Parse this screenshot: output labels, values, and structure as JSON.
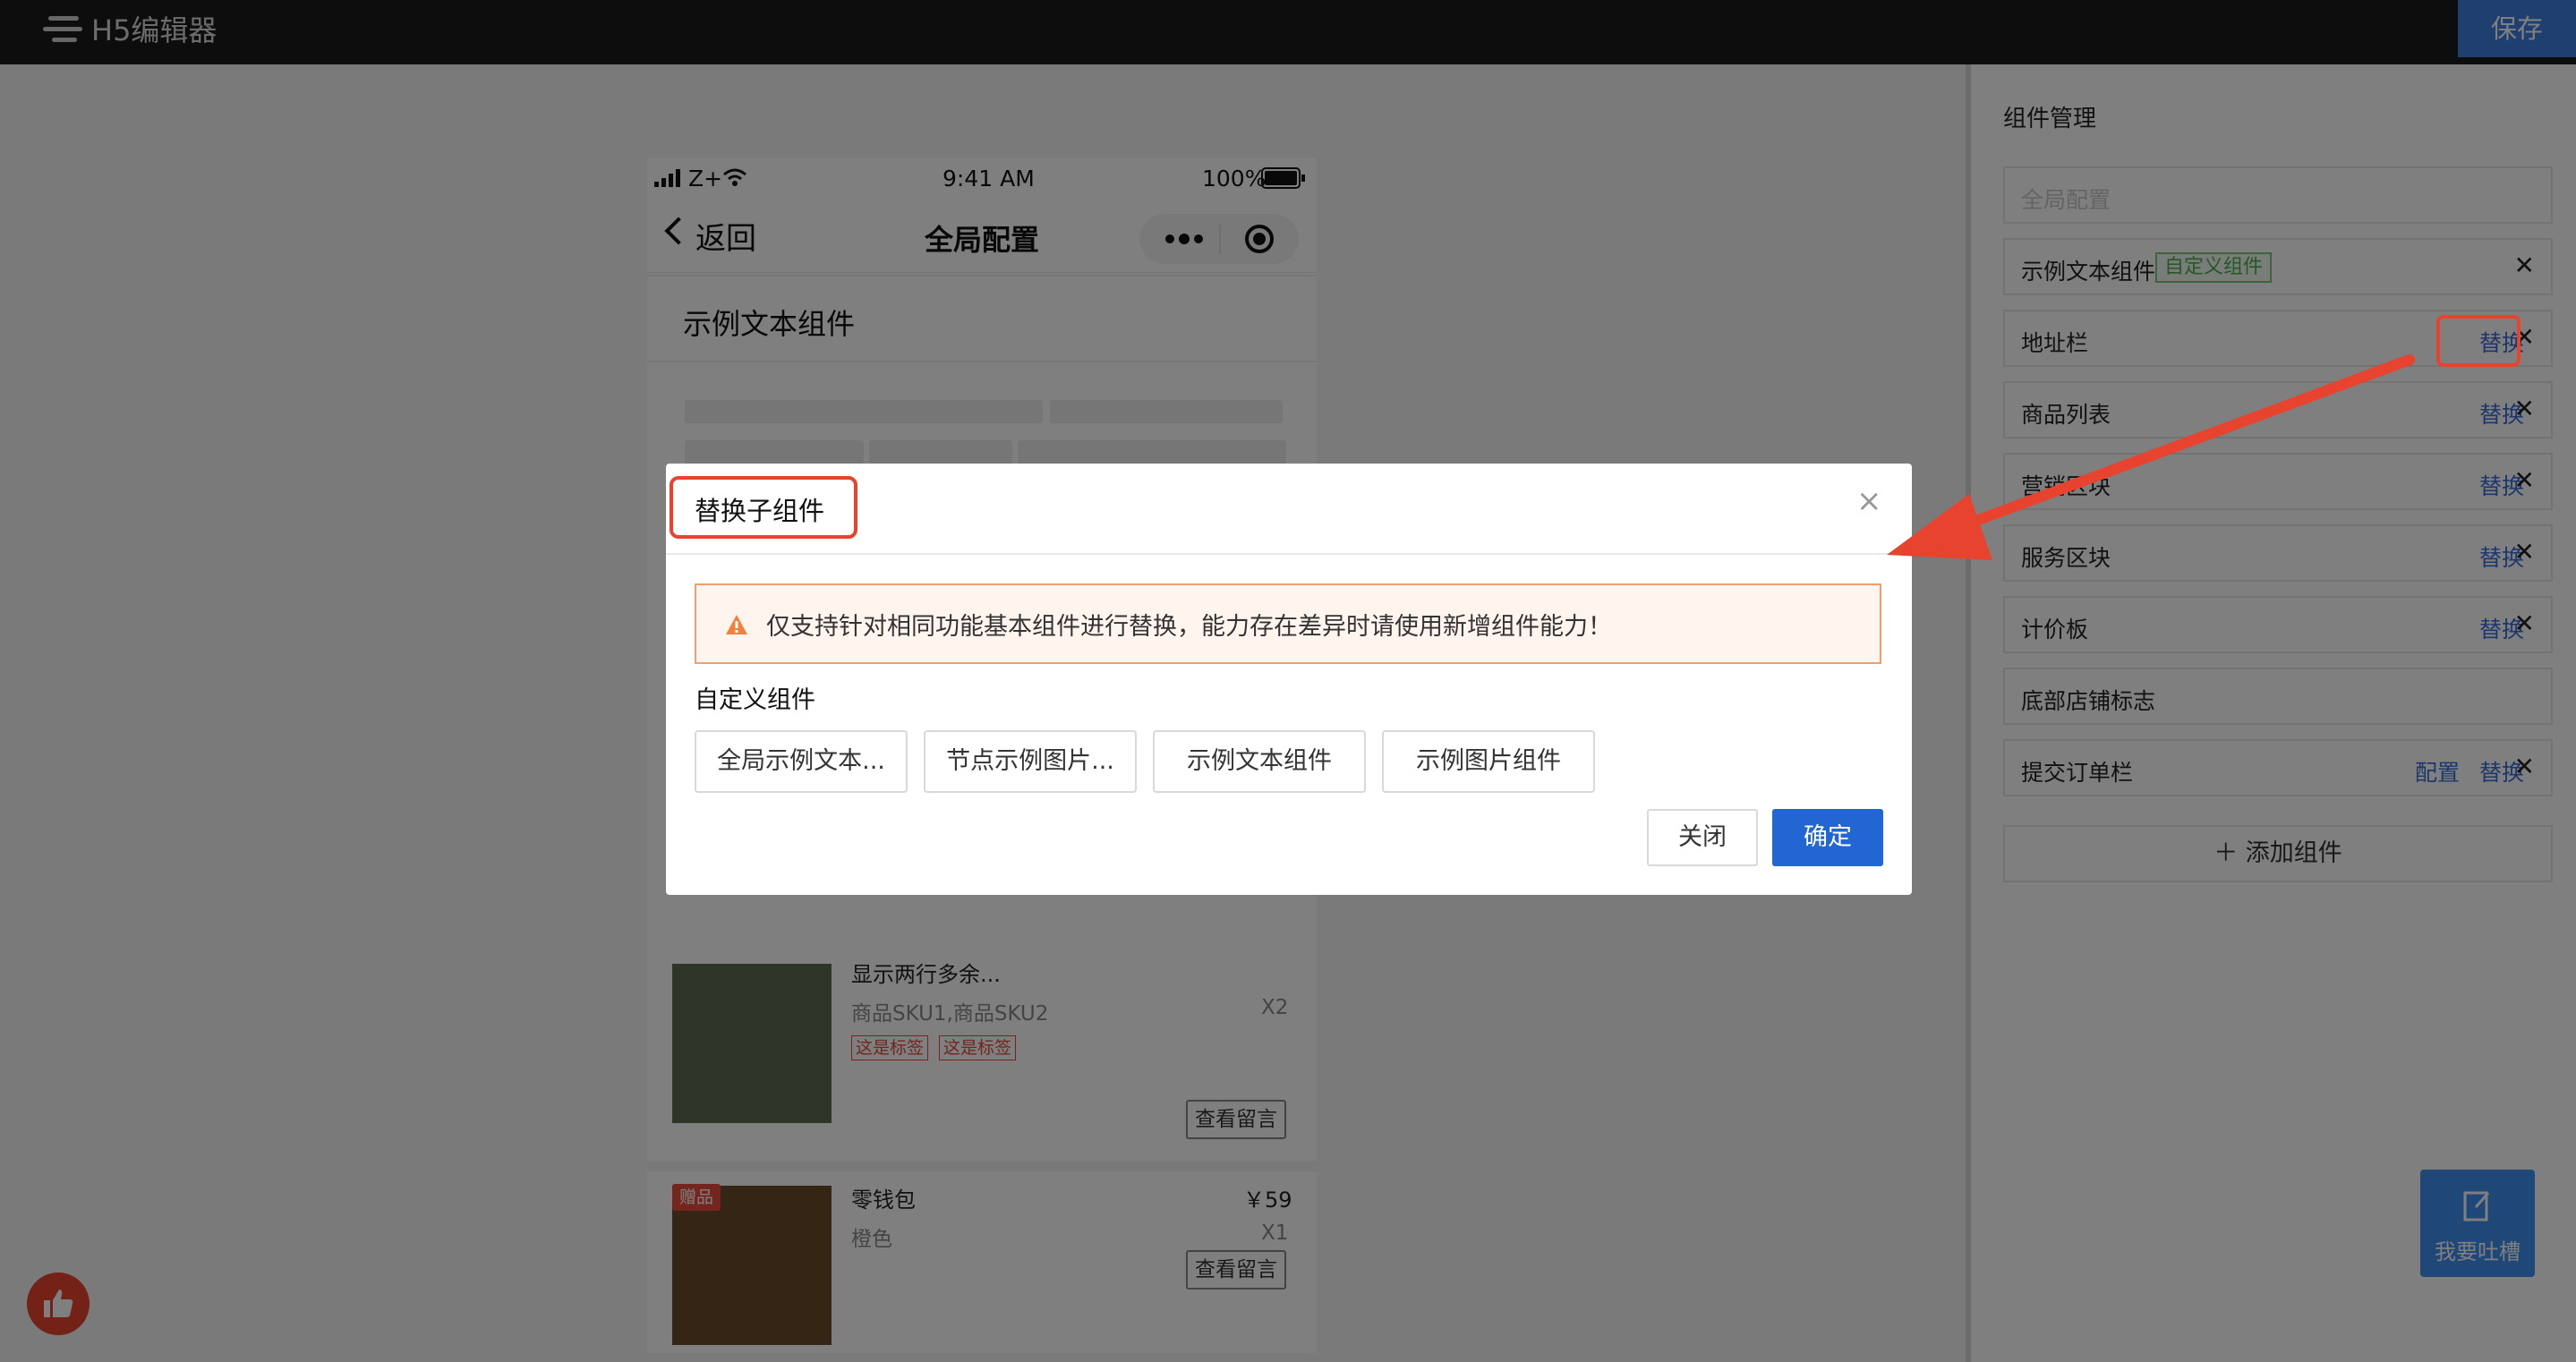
{
  "topbar": {
    "title": "H5编辑器",
    "save_label": "保存"
  },
  "phone": {
    "status": {
      "carrier": "Z+",
      "time": "9:41 AM",
      "battery": "100%"
    },
    "nav": {
      "back_label": "返回",
      "title": "全局配置"
    },
    "component_title": "示例文本组件",
    "goods": [
      {
        "name": "显示两行多余...",
        "spec": "商品SKU1,商品SKU2",
        "qty": "X2",
        "tags": [
          "这是标签",
          "这是标签"
        ],
        "button": "查看留言"
      },
      {
        "badge": "赠品",
        "name": "零钱包",
        "price": "￥59",
        "spec": "橙色",
        "qty": "X1",
        "button": "查看留言"
      }
    ]
  },
  "panel": {
    "title": "组件管理",
    "global_placeholder": "全局配置",
    "custom_tag": "自定义组件",
    "rows": [
      {
        "label": "示例文本组件",
        "actions": []
      },
      {
        "label": "地址栏",
        "actions": [
          "替换"
        ]
      },
      {
        "label": "商品列表",
        "actions": [
          "替换"
        ]
      },
      {
        "label": "营销区块",
        "actions": [
          "替换"
        ]
      },
      {
        "label": "服务区块",
        "actions": [
          "替换"
        ]
      },
      {
        "label": "计价板",
        "actions": [
          "替换"
        ]
      },
      {
        "label": "底部店铺标志",
        "actions": []
      },
      {
        "label": "提交订单栏",
        "actions": [
          "配置",
          "替换"
        ]
      }
    ],
    "add_label": "添加组件"
  },
  "dialog": {
    "title": "替换子组件",
    "alert": "仅支持针对相同功能基本组件进行替换，能力存在差异时请使用新增组件能力！",
    "section_label": "自定义组件",
    "options": [
      "全局示例文本...",
      "节点示例图片...",
      "示例文本组件",
      "示例图片组件"
    ],
    "close_label": "关闭",
    "ok_label": "确定"
  },
  "feedback": {
    "label": "我要吐槽"
  },
  "colors": {
    "primary": "#2266d4",
    "annotation": "#e8432e",
    "topbar": "#1b1b1b"
  }
}
